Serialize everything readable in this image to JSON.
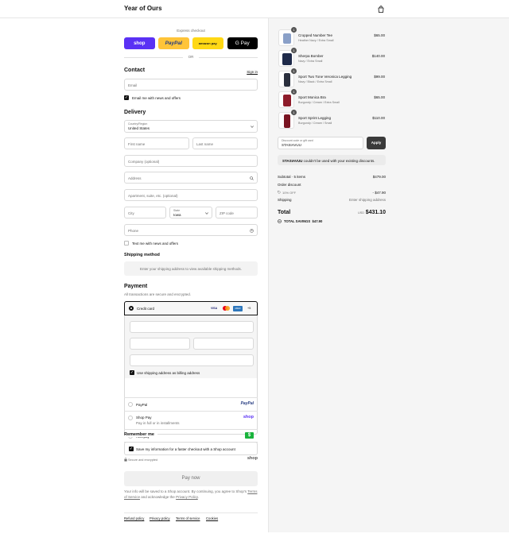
{
  "header": {
    "brand": "Year of Ours",
    "cart_icon": "shopping-bag-icon"
  },
  "express": {
    "label": "Express checkout",
    "buttons": [
      {
        "label": "shop",
        "bg": "#5a31f4",
        "color": "#ffffff"
      },
      {
        "label": "PayPal",
        "bg": "#ffc439",
        "color": "#253b80"
      },
      {
        "label": "amazon pay",
        "bg": "#ffd814",
        "color": "#111111"
      },
      {
        "label": "G Pay",
        "bg": "#000000",
        "color": "#ffffff"
      }
    ],
    "or": "OR"
  },
  "contact": {
    "title": "Contact",
    "sign_in": "Sign in",
    "email_placeholder": "Email",
    "news_label": "Email me with news and offers"
  },
  "delivery": {
    "title": "Delivery",
    "country_label": "Country/Region",
    "country_value": "United States",
    "first_name": "First name",
    "last_name": "Last name",
    "company": "Company (optional)",
    "address": "Address",
    "apartment": "Apartment, suite, etc. (optional)",
    "city": "City",
    "state_label": "State",
    "state_value": "Iowa",
    "zip": "ZIP code",
    "phone": "Phone",
    "text_label": "Text me with news and offers"
  },
  "shipping_method": {
    "title": "Shipping method",
    "message": "Enter your shipping address to view available shipping methods."
  },
  "payment": {
    "title": "Payment",
    "subtitle": "All transactions are secure and encrypted.",
    "credit_card_label": "Credit card",
    "card_badges": [
      "VISA",
      "MC",
      "AMEX",
      "+5"
    ],
    "billing_label": "Use shipping address as billing address",
    "paypal_label": "PayPal",
    "paypal_logo": "PayPal",
    "shoppay_label": "Shop Pay",
    "shoppay_sub": "Pay in full or in installments",
    "shoppay_logo": "shop",
    "afterpay_label": "Afterpay",
    "afterpay_logo": "$"
  },
  "remember": {
    "title": "Remember me",
    "save_label": "Save my information for a faster checkout with a Shop account",
    "secure_label": "Secure and encrypted",
    "shop_logo": "shop"
  },
  "pay_now": "Pay now",
  "disclaimer": {
    "prefix": "Your info will be saved to a Shop account. By continuing, you agree to Shop's",
    "terms": "Terms of Service",
    "middle": "and acknowledge the",
    "privacy": "Privacy Policy",
    "suffix": "."
  },
  "footer_links": [
    "Refund policy",
    "Privacy policy",
    "Terms of service",
    "Cookies"
  ],
  "order": {
    "items": [
      {
        "name": "Cropped Number Tee",
        "variant": "Heather Navy / Extra Small",
        "price": "$65.00",
        "qty": "1",
        "color": "#8aa0c8"
      },
      {
        "name": "Sherpa Bomber",
        "variant": "Navy / Extra Small",
        "price": "$140.00",
        "qty": "1",
        "color": "#1e2a4a"
      },
      {
        "name": "Sport Two Tone Veronica Legging",
        "variant": "Navy / Black / Extra Small",
        "price": "$99.00",
        "qty": "1",
        "color": "#2a2f3d"
      },
      {
        "name": "Sport Monica Bra",
        "variant": "Burgundy / Cream / Extra Small",
        "price": "$65.00",
        "qty": "1",
        "color": "#8e1c2a"
      },
      {
        "name": "Sport Sprint Legging",
        "variant": "Burgundy / Cream / Small",
        "price": "$110.00",
        "qty": "1",
        "color": "#7a1422"
      }
    ],
    "discount_label": "Discount code or gift card",
    "discount_value": "STASIAVUU",
    "apply": "Apply",
    "error_code": "STASIAVUU",
    "error_text": "couldn't be used with your existing discounts.",
    "subtotal_label": "Subtotal · 5 items",
    "subtotal_value": "$479.00",
    "order_discount_label": "Order discount",
    "discount_tag": "10% OFF",
    "discount_amount": "- $47.90",
    "shipping_label": "Shipping",
    "shipping_value": "Enter shipping address",
    "total_label": "Total",
    "currency": "USD",
    "total_value": "$431.10",
    "savings_label": "TOTAL SAVINGS",
    "savings_value": "$47.90"
  }
}
